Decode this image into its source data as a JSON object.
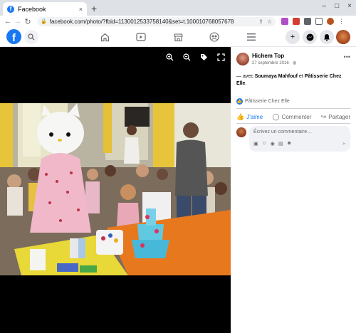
{
  "browser": {
    "tab_title": "Facebook",
    "tab_close": "×",
    "new_tab": "+",
    "url": "facebook.com/photo/?fbid=113001253375814​0&set=t.100010768057678",
    "window_controls": [
      "–",
      "□",
      "×"
    ]
  },
  "fb": {
    "logo": "f"
  },
  "photo": {
    "tools": [
      "zoom-in",
      "zoom-out",
      "tag",
      "fullscreen"
    ]
  },
  "post": {
    "author": "Hichem Top",
    "date": "27 septembre 2016 · ",
    "caption_prefix": "— avec ",
    "tag1": "Soumaya Mahfouf",
    "caption_and": " et ",
    "tag2": "Pâtisserie Chez Elle",
    "caption_suffix": ".",
    "reaction_by": "Pâtisserie Chez Elle",
    "like_label": "J'aime",
    "comment_label": "Commenter",
    "share_label": "Partager",
    "comment_placeholder": "Écrivez un commentaire…"
  }
}
